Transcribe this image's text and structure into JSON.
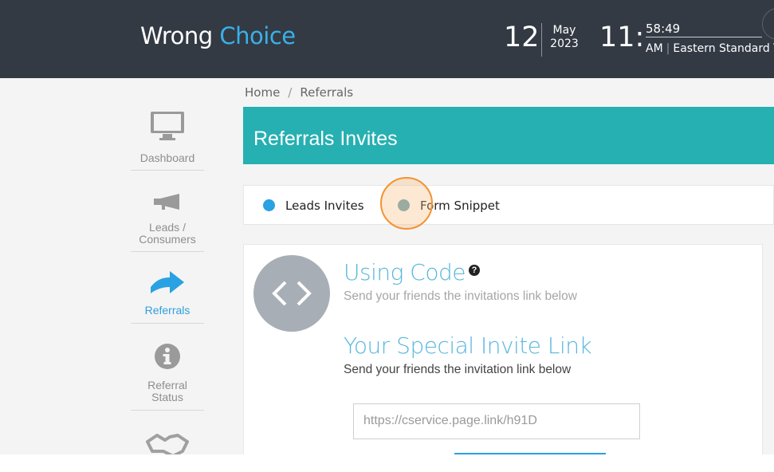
{
  "header": {
    "brand_part1": "Wrong",
    "brand_part2": "Choice",
    "date_day": "12",
    "date_month": "May",
    "date_year": "2023",
    "time_hour": "11:",
    "time_seconds": "58:49",
    "time_ampm": "AM",
    "timezone": "Eastern Standard T..."
  },
  "breadcrumb": {
    "home": "Home",
    "separator": "/",
    "current": "Referrals"
  },
  "sidebar": {
    "items": [
      {
        "label": "Dashboard",
        "icon": "monitor-icon",
        "active": false
      },
      {
        "label": "Leads / Consumers",
        "icon": "megaphone-icon",
        "active": false
      },
      {
        "label": "Referrals",
        "icon": "arrow-right-icon",
        "active": true
      },
      {
        "label": "Referral Status",
        "icon": "info-icon",
        "active": false
      },
      {
        "label": "",
        "icon": "handshake-icon",
        "active": false
      }
    ]
  },
  "page": {
    "title": "Referrals Invites"
  },
  "tabs": [
    {
      "label": "Leads Invites",
      "selected": true
    },
    {
      "label": "Form Snippet",
      "selected": false
    }
  ],
  "card": {
    "heading": "Using Code",
    "help_glyph": "?",
    "subtitle": "Send your friends the invitations link below",
    "invite_heading": "Your Special Invite Link",
    "invite_subtitle": "Send your friends the invitation link below",
    "invite_link": "https://cservice.page.link/h91D"
  },
  "colors": {
    "header_bg": "#333a44",
    "brand_accent": "#3ab0e8",
    "banner_teal": "#26b0b2",
    "active_blue": "#2aa1e3",
    "cursor_orange": "#f39330"
  }
}
